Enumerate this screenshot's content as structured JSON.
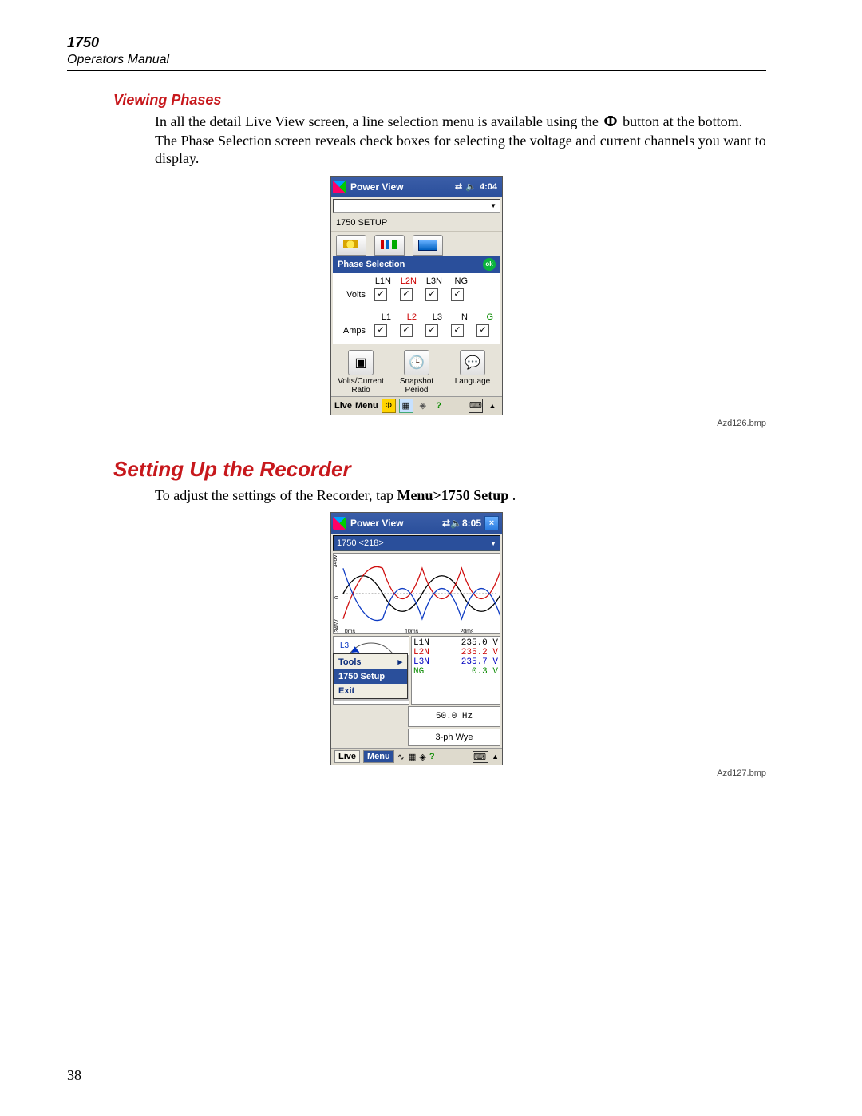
{
  "header": {
    "model": "1750",
    "subtitle": "Operators Manual"
  },
  "sections": {
    "viewing_phases": {
      "title": "Viewing Phases",
      "para_pre": "In all the detail Live View screen, a line selection menu is available using the ",
      "para_post": " button at the bottom. The Phase Selection screen reveals check boxes for selecting the voltage and current channels you want to display."
    },
    "setup": {
      "title": "Setting Up the Recorder",
      "para_pre": "To adjust the settings of the Recorder, tap ",
      "bold": "Menu>1750 Setup",
      "para_post": "."
    }
  },
  "fig1": {
    "titlebar": "Power View",
    "time": "4:04",
    "setup": "1750 SETUP",
    "phase_selection": "Phase Selection",
    "ok": "ok",
    "volts_label": "Volts",
    "amps_label": "Amps",
    "cols_v": [
      "L1N",
      "L2N",
      "L3N",
      "NG",
      ""
    ],
    "cols_a": [
      "L1",
      "L2",
      "L3",
      "N",
      "G"
    ],
    "v_checks": [
      true,
      true,
      true,
      true,
      false
    ],
    "a_checks": [
      true,
      true,
      true,
      true,
      true
    ],
    "bottom": {
      "a": "Volts/Current Ratio",
      "b": "Snapshot Period",
      "c": "Language"
    },
    "menubar": {
      "a": "Live",
      "b": "Menu"
    },
    "caption": "Azd126.bmp"
  },
  "fig2": {
    "titlebar": "Power View",
    "time": "8:05",
    "addr": "1750 <218>",
    "xticks": [
      "0ms",
      "10ms",
      "20ms"
    ],
    "yticks_top": "346V",
    "yticks_mid": "0",
    "yticks_bot": "346V",
    "sel_phase": "L3",
    "legend": [
      {
        "label": "L1N",
        "val": "235.0",
        "unit": "V",
        "cls": ""
      },
      {
        "label": "L2N",
        "val": "235.2",
        "unit": "V",
        "cls": "red"
      },
      {
        "label": "L3N",
        "val": "235.7",
        "unit": "V",
        "cls": "blu"
      },
      {
        "label": "NG",
        "val": "0.3",
        "unit": "V",
        "cls": "grn"
      }
    ],
    "menu_items": [
      "Tools",
      "1750 Setup",
      "Exit"
    ],
    "hz": "50.0 Hz",
    "wiring": "3-ph Wye",
    "menubar": {
      "live": "Live",
      "menu": "Menu"
    },
    "caption": "Azd127.bmp"
  },
  "phi_char": "Ф",
  "page_number": "38"
}
